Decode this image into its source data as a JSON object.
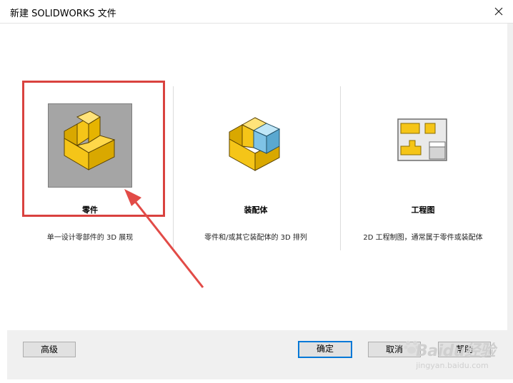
{
  "window": {
    "title": "新建 SOLIDWORKS 文件",
    "close_glyph": "✕"
  },
  "options": [
    {
      "name": "零件",
      "description": "单一设计零部件的 3D 展现",
      "icon": "part-icon",
      "selected": true
    },
    {
      "name": "装配体",
      "description": "零件和/或其它装配体的 3D 排列",
      "icon": "assembly-icon",
      "selected": false
    },
    {
      "name": "工程图",
      "description": "2D 工程制图，通常属于零件或装配体",
      "icon": "drawing-icon",
      "selected": false
    }
  ],
  "buttons": {
    "advanced": "高级",
    "ok": "确定",
    "cancel": "取消",
    "help": "帮助"
  },
  "watermark": {
    "main": "Baidu经验",
    "sub": "jingyan.baidu.com"
  },
  "colors": {
    "selection_frame": "#d9423f",
    "part_yellow": "#f5c518",
    "assembly_blue": "#7fc3e6",
    "default_button_border": "#0078d7"
  }
}
